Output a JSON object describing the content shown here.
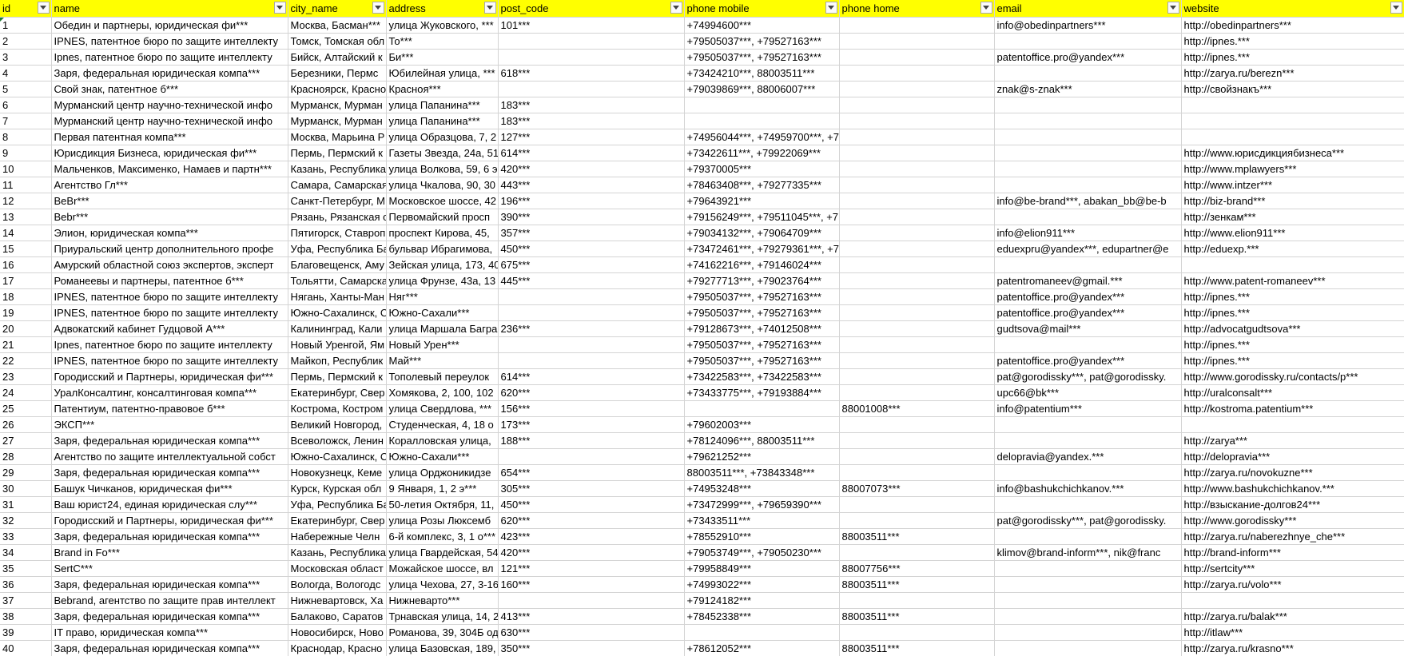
{
  "columns": [
    "id",
    "name",
    "city_name",
    "address",
    "post_code",
    "phone mobile",
    "phone home",
    "email",
    "website"
  ],
  "rows": [
    [
      "1",
      "Обедин и партнеры, юридическая фи***",
      "Москва, Басман***",
      "улица Жуковского, ***",
      "101***",
      "+74994600***",
      "",
      "info@obedinpartners***",
      "http://obedinpartners***"
    ],
    [
      "2",
      "IPNES, патентное бюро по защите интеллекту",
      "Томск, Томская обл",
      "То***",
      "",
      "+79505037***, +79527163***",
      "",
      "",
      "http://ipnes.***"
    ],
    [
      "3",
      "Ipnes, патентное бюро по защите интеллекту",
      "Бийск, Алтайский к",
      "Би***",
      "",
      "+79505037***, +79527163***",
      "",
      "patentoffice.pro@yandex***",
      "http://ipnes.***"
    ],
    [
      "4",
      "Заря, федеральная юридическая компа***",
      "Березники, Пермс",
      "Юбилейная улица, ***",
      "618***",
      "+73424210***, 88003511***",
      "",
      "",
      "http://zarya.ru/berezn***"
    ],
    [
      "5",
      "Свой знак, патентное б***",
      "Красноярск, Красно",
      "Красноя***",
      "",
      "+79039869***, 88006007***",
      "",
      "znak@s-znak***",
      "http://свойзнакъ***"
    ],
    [
      "6",
      "Мурманский центр научно-технической инфо",
      "Мурманск, Мурман",
      "улица Папанина***",
      "183***",
      "",
      "",
      "",
      ""
    ],
    [
      "7",
      "Мурманский центр научно-технической инфо",
      "Мурманск, Мурман",
      "улица Папанина***",
      "183***",
      "",
      "",
      "",
      ""
    ],
    [
      "8",
      "Первая патентная компа***",
      "Москва, Марьина Р",
      "улица Образцова, 7, 2",
      "127***",
      "+74956044***, +74959700***, +7",
      "",
      "",
      ""
    ],
    [
      "9",
      "Юрисдикция Бизнеса, юридическая фи***",
      "Пермь, Пермский к",
      "Газеты Звезда, 24a, 51",
      "614***",
      "+73422611***, +79922069***",
      "",
      "",
      "http://www.юрисдикциябизнеса***"
    ],
    [
      "10",
      "Мальченков, Максименко, Намаев и партн***",
      "Казань, Республика",
      "улица Волкова, 59, 6 э",
      "420***",
      "+79370005***",
      "",
      "",
      "http://www.mplawyers***"
    ],
    [
      "11",
      "Агентство Гл***",
      "Самара, Самарская",
      "улица Чкалова, 90, 30",
      "443***",
      "+78463408***, +79277335***",
      "",
      "",
      "http://www.intzer***"
    ],
    [
      "12",
      "BeBr***",
      "Санкт-Петербург, М",
      "Московское шоссе, 42",
      "196***",
      "+79643921***",
      "",
      "info@be-brand***, abakan_bb@be-b",
      "http://biz-brand***"
    ],
    [
      "13",
      "Bebr***",
      "Рязань, Рязанская о",
      "Первомайский просп",
      "390***",
      "+79156249***, +79511045***, +7",
      "",
      "",
      "http://зенкам***"
    ],
    [
      "14",
      "Элион, юридическая компа***",
      "Пятигорск, Ставроп",
      "проспект Кирова, 45,",
      "357***",
      "+79034132***, +79064709***",
      "",
      "info@elion911***",
      "http://www.elion911***"
    ],
    [
      "15",
      "Приуральский центр дополнительного профе",
      "Уфа, Республика Ба",
      "бульвар Ибрагимова,",
      "450***",
      "+73472461***, +79279361***, +7",
      "",
      "eduexpru@yandex***, edupartner@e",
      "http://eduexp.***"
    ],
    [
      "16",
      "Амурский областной союз экспертов, эксперт",
      "Благовещенск, Аму",
      "Зейская улица, 173, 40",
      "675***",
      "+74162216***, +79146024***",
      "",
      "",
      ""
    ],
    [
      "17",
      "Романеевы и партнеры, патентное б***",
      "Тольятти, Самарска",
      "улица Фрунзе, 43a, 13",
      "445***",
      "+79277713***, +79023764***",
      "",
      "patentromaneev@gmail.***",
      "http://www.patent-romaneev***"
    ],
    [
      "18",
      "IPNES, патентное бюро по защите интеллекту",
      "Нягань, Ханты-Ман",
      "Няг***",
      "",
      "+79505037***, +79527163***",
      "",
      "patentoffice.pro@yandex***",
      "http://ipnes.***"
    ],
    [
      "19",
      "IPNES, патентное бюро по защите интеллекту",
      "Южно-Сахалинск, С",
      "Южно-Сахали***",
      "",
      "+79505037***, +79527163***",
      "",
      "patentoffice.pro@yandex***",
      "http://ipnes.***"
    ],
    [
      "20",
      "Адвокатский кабинет Гудцовой А***",
      "Калининград, Кали",
      "улица Маршала Багра",
      "236***",
      "+79128673***, +74012508***",
      "",
      "gudtsova@mail***",
      "http://advocatgudtsova***"
    ],
    [
      "21",
      "Ipnes, патентное бюро по защите интеллекту",
      "Новый Уренгой, Ям",
      "Новый Урен***",
      "",
      "+79505037***, +79527163***",
      "",
      "",
      "http://ipnes.***"
    ],
    [
      "22",
      "IPNES, патентное бюро по защите интеллекту",
      "Майкоп, Республик",
      "Май***",
      "",
      "+79505037***, +79527163***",
      "",
      "patentoffice.pro@yandex***",
      "http://ipnes.***"
    ],
    [
      "23",
      "Городисский и Партнеры, юридическая фи***",
      "Пермь, Пермский к",
      "Тополевый переулок",
      "614***",
      "+73422583***, +73422583***",
      "",
      "pat@gorodissky***, pat@gorodissky.",
      "http://www.gorodissky.ru/contacts/p***"
    ],
    [
      "24",
      "УралКонсалтинг, консалтинговая компа***",
      "Екатеринбург, Свер",
      "Хомякова, 2, 100, 102",
      "620***",
      "+73433775***, +79193884***",
      "",
      "upc66@bk***",
      "http://uralconsalt***"
    ],
    [
      "25",
      "Патентиум, патентно-правовое б***",
      "Кострома, Костром",
      "улица Свердлова, ***",
      "156***",
      "",
      "88001008***",
      "info@patentium***",
      "http://kostroma.patentium***"
    ],
    [
      "26",
      "ЭКСП***",
      "Великий Новгород,",
      "Студенческая, 4, 18 о",
      "173***",
      "+79602003***",
      "",
      "",
      ""
    ],
    [
      "27",
      "Заря, федеральная юридическая компа***",
      "Всеволожск, Ленин",
      "Коралловская улица,",
      "188***",
      "+78124096***, 88003511***",
      "",
      "",
      "http://zarya***"
    ],
    [
      "28",
      "Агентство по защите интеллектуальной собст",
      "Южно-Сахалинск, С",
      "Южно-Сахали***",
      "",
      "+79621252***",
      "",
      "delopravia@yandex.***",
      "http://delopravia***"
    ],
    [
      "29",
      "Заря, федеральная юридическая компа***",
      "Новокузнецк, Кеме",
      "улица Орджоникидзе",
      "654***",
      "88003511***, +73843348***",
      "",
      "",
      "http://zarya.ru/novokuzne***"
    ],
    [
      "30",
      "Башук Чичканов, юридическая фи***",
      "Курск, Курская обл",
      "9 Января, 1, 2 э***",
      "305***",
      "+74953248***",
      "88007073***",
      "info@bashukchichkanov.***",
      "http://www.bashukchichkanov.***"
    ],
    [
      "31",
      "Ваш юрист24, единая юридическая слу***",
      "Уфа, Республика Ба",
      "50-летия Октября, 11,",
      "450***",
      "+73472999***, +79659390***",
      "",
      "",
      "http://взыскание-долгов24***"
    ],
    [
      "32",
      "Городисский и Партнеры, юридическая фи***",
      "Екатеринбург, Свер",
      "улица Розы Люксемб",
      "620***",
      "+73433511***",
      "",
      "pat@gorodissky***, pat@gorodissky.",
      "http://www.gorodissky***"
    ],
    [
      "33",
      "Заря, федеральная юридическая компа***",
      "Набережные Челн",
      "6-й комплекс, 3, 1 о***",
      "423***",
      "+78552910***",
      "88003511***",
      "",
      "http://zarya.ru/naberezhnye_che***"
    ],
    [
      "34",
      "Brand in Fo***",
      "Казань, Республика",
      "улица Гвардейская, 54",
      "420***",
      "+79053749***, +79050230***",
      "",
      "klimov@brand-inform***, nik@franc",
      "http://brand-inform***"
    ],
    [
      "35",
      "SertC***",
      "Московская област",
      "Можайское шоссе, вл",
      "121***",
      "+79958849***",
      "88007756***",
      "",
      "http://sertcity***"
    ],
    [
      "36",
      "Заря, федеральная юридическая компа***",
      "Вологда, Вологодс",
      "улица Чехова, 27, 3-16",
      "160***",
      "+74993022***",
      "88003511***",
      "",
      "http://zarya.ru/volo***"
    ],
    [
      "37",
      "Bebrand, агентство по защите прав интеллект",
      "Нижневартовск, Ха",
      "Нижневарто***",
      "",
      "+79124182***",
      "",
      "",
      ""
    ],
    [
      "38",
      "Заря, федеральная юридическая компа***",
      "Балаково, Саратов",
      "Трнавская улица, 14, 2",
      "413***",
      "+78452338***",
      "88003511***",
      "",
      "http://zarya.ru/balak***"
    ],
    [
      "39",
      "IT право, юридическая компа***",
      "Новосибирск, Ново",
      "Романова, 39, 304Б од",
      "630***",
      "",
      "",
      "",
      "http://itlaw***"
    ],
    [
      "40",
      "Заря, федеральная юридическая компа***",
      "Краснодар, Красно",
      "улица Базовская, 189,",
      "350***",
      "+78612052***",
      "88003511***",
      "",
      "http://zarya.ru/krasno***"
    ]
  ]
}
